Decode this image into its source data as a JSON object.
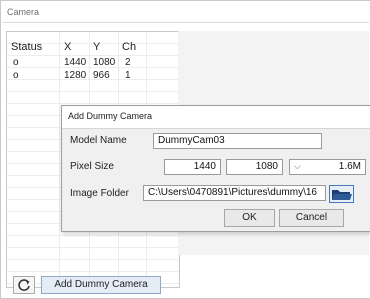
{
  "window": {
    "title": "Camera"
  },
  "table": {
    "headers": [
      "Status",
      "X",
      "Y",
      "Ch"
    ],
    "rows": [
      {
        "status": "o",
        "x": "1440",
        "y": "1080",
        "ch": "2"
      },
      {
        "status": "o",
        "x": "1280",
        "y": "966",
        "ch": "1"
      }
    ]
  },
  "dialog": {
    "title": "Add Dummy Camera",
    "model_name_label": "Model Name",
    "model_name_value": "DummyCam03",
    "pixel_size_label": "Pixel Size",
    "pixel_width": "1440",
    "pixel_height": "1080",
    "pixel_dropdown_icon": "chevron-down-icon",
    "pixel_megapixels": "1.6M",
    "image_folder_label": "Image Folder",
    "image_folder_value": "C:\\Users\\0470891\\Pictures\\dummy\\16",
    "ok_label": "OK",
    "cancel_label": "Cancel"
  },
  "toolbar": {
    "refresh_icon": "refresh-icon",
    "add_label": "Add Dummy Camera"
  },
  "colors": {
    "folder_icon": "#1f3f73",
    "accent": "#4a78b7"
  }
}
